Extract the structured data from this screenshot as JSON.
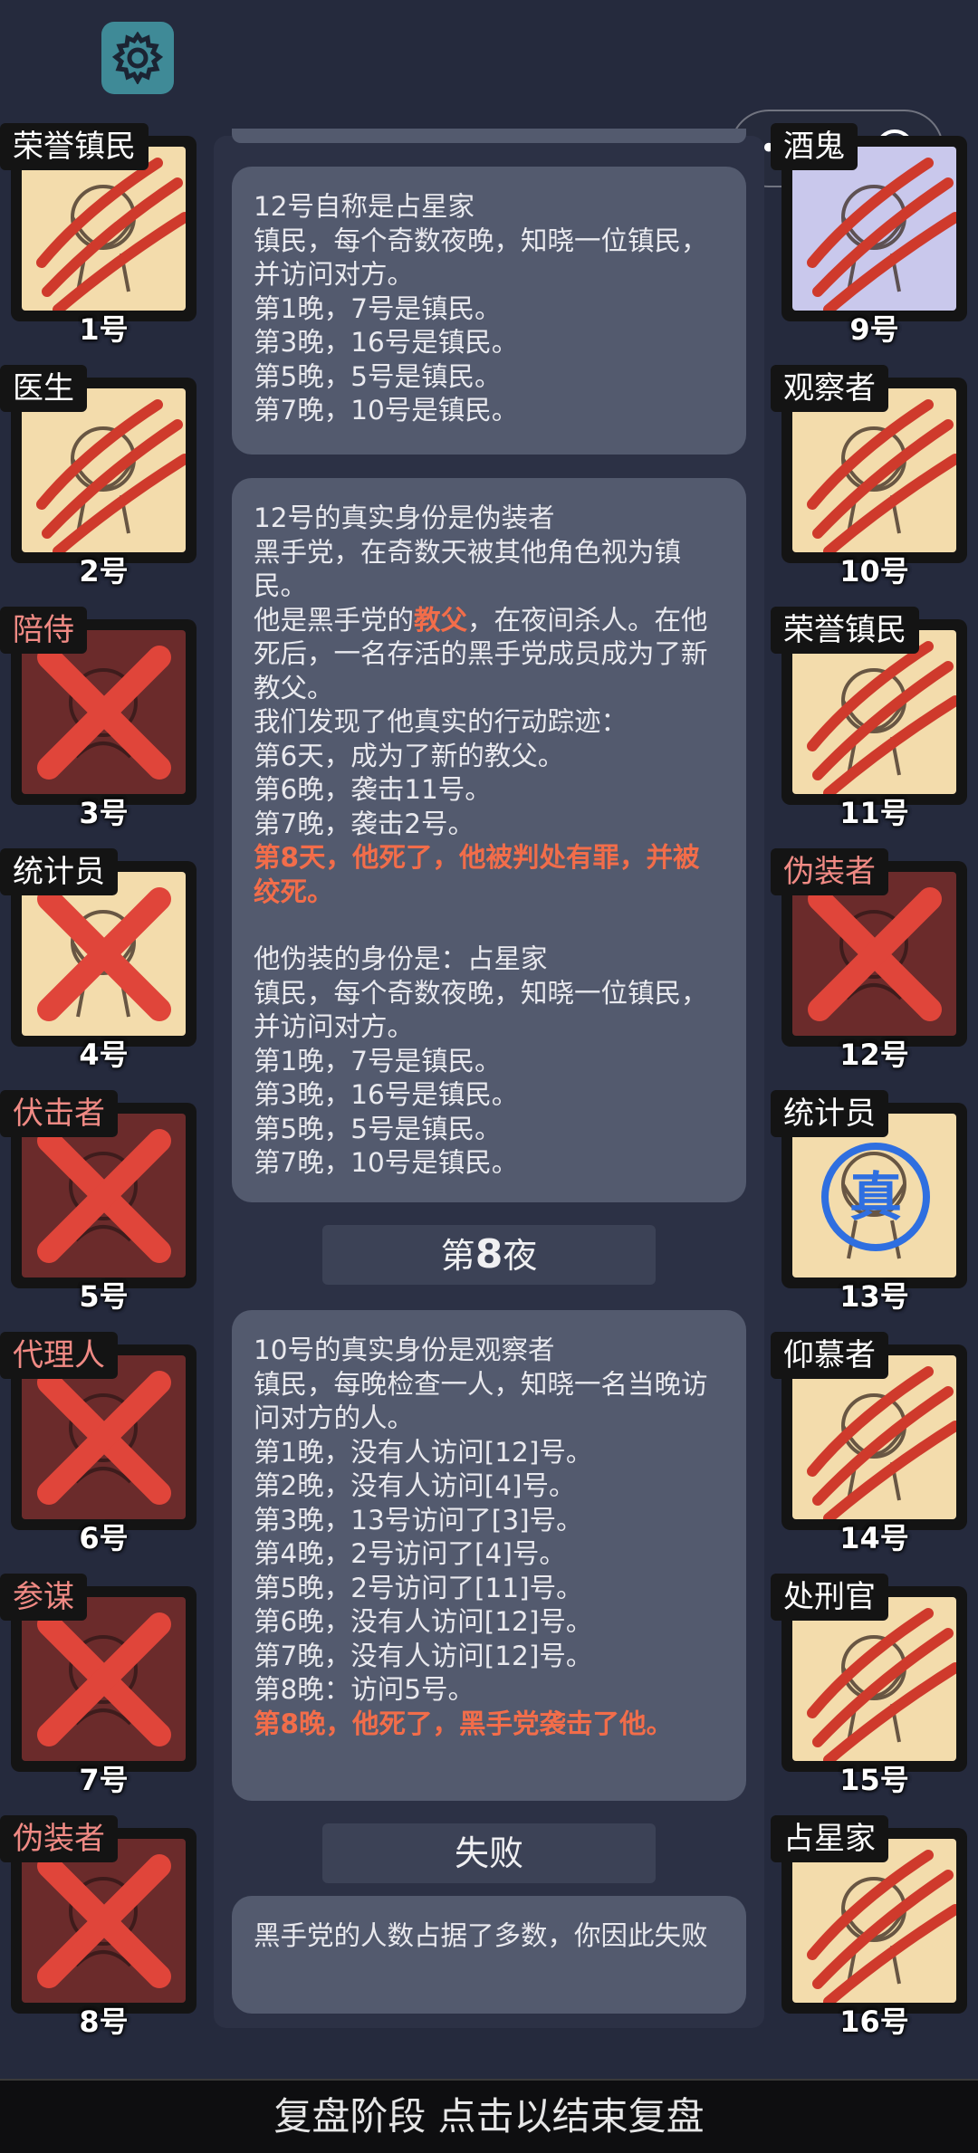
{
  "header": {
    "settings_icon": "gear-icon",
    "capsule_more": "•●•",
    "capsule_icon": "target-icon"
  },
  "left_players": [
    {
      "role": "荣誉镇民",
      "number": "1号",
      "state": "slashed"
    },
    {
      "role": "医生",
      "number": "2号",
      "state": "slashed"
    },
    {
      "role": "陪侍",
      "number": "3号",
      "state": "dead"
    },
    {
      "role": "统计员",
      "number": "4号",
      "state": "crossed"
    },
    {
      "role": "伏击者",
      "number": "5号",
      "state": "dead"
    },
    {
      "role": "代理人",
      "number": "6号",
      "state": "dead"
    },
    {
      "role": "参谋",
      "number": "7号",
      "state": "dead"
    },
    {
      "role": "伪装者",
      "number": "8号",
      "state": "dead"
    }
  ],
  "right_players": [
    {
      "role": "酒鬼",
      "number": "9号",
      "state": "slashed"
    },
    {
      "role": "观察者",
      "number": "10号",
      "state": "slashed"
    },
    {
      "role": "荣誉镇民",
      "number": "11号",
      "state": "slashed"
    },
    {
      "role": "伪装者",
      "number": "12号",
      "state": "dead"
    },
    {
      "role": "统计员",
      "number": "13号",
      "state": "true",
      "stamp": "真"
    },
    {
      "role": "仰慕者",
      "number": "14号",
      "state": "slashed"
    },
    {
      "role": "处刑官",
      "number": "15号",
      "state": "slashed"
    },
    {
      "role": "占星家",
      "number": "16号",
      "state": "slashed"
    }
  ],
  "log": {
    "bubble1": [
      "12号自称是占星家",
      "镇民，每个奇数夜晚，知晓一位镇民，并访问对方。",
      "第1晚，7号是镇民。",
      "第3晚，16号是镇民。",
      "第5晚，5号是镇民。",
      "第7晚，10号是镇民。"
    ],
    "bubble2": {
      "l1": "12号的真实身份是伪装者",
      "l2": "黑手党，在奇数天被其他角色视为镇民。",
      "l3a": "他是黑手党的",
      "l3b": "教父",
      "l3c": "，在夜间杀人。在他死后，一名存活的黑手党成员成为了新教父。",
      "l4": "我们发现了他真实的行动踪迹：",
      "l5": "第6天，成为了新的教父。",
      "l6": "第6晚，袭击11号。",
      "l7": "第7晚，袭击2号。",
      "l8": "第8天，他死了，他被判处有罪，并被绞死。",
      "l9": "他伪装的身份是：占星家",
      "l10": "镇民，每个奇数夜晚，知晓一位镇民，并访问对方。",
      "l11": "第1晚，7号是镇民。",
      "l12": "第3晚，16号是镇民。",
      "l13": "第5晚，5号是镇民。",
      "l14": "第7晚，10号是镇民。"
    },
    "night_divider": {
      "prefix": "第",
      "num": "8",
      "suffix": "夜"
    },
    "bubble3": {
      "lines": [
        "10号的真实身份是观察者",
        "镇民，每晚检查一人，知晓一名当晚访问对方的人。",
        "第1晚，没有人访问[12]号。",
        "第2晚，没有人访问[4]号。",
        "第3晚，13号访问了[3]号。",
        "第4晚，2号访问了[4]号。",
        "第5晚，2号访问了[11]号。",
        "第6晚，没有人访问[12]号。",
        "第7晚，没有人访问[12]号。",
        "第8晚：访问5号。"
      ],
      "red": "第8晚，他死了，黑手党袭击了他。"
    },
    "result_divider": "失败",
    "bubble4": "黑手党的人数占据了多数，你因此失败"
  },
  "bottom_bar": "复盘阶段 点击以结束复盘",
  "colors": {
    "background": "#252a3d",
    "bubble": "#535a6e",
    "highlight": "#f26d4a",
    "card_face": "#f3dcac",
    "dead_face": "#6b2b2b",
    "slash": "#cf3a2c"
  }
}
